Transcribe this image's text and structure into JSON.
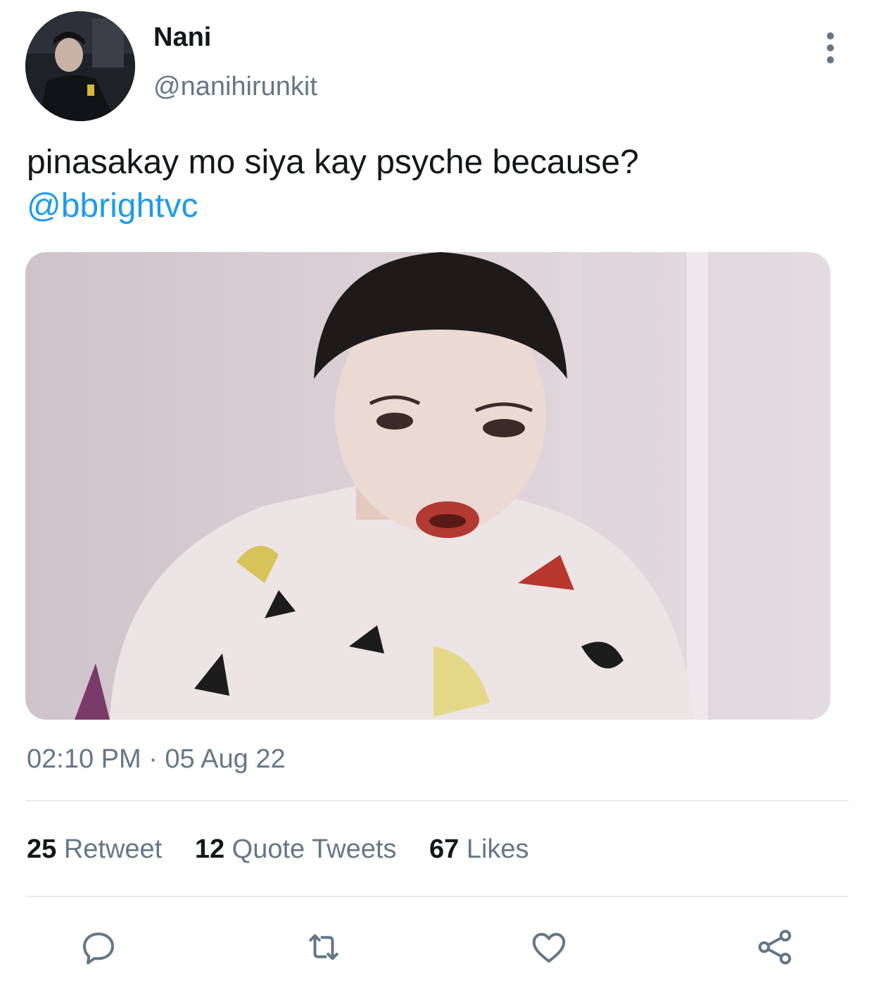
{
  "tweet": {
    "author": {
      "display_name": "Nani",
      "handle": "@nanihirunkit",
      "avatar": "avatar-photo"
    },
    "text_line_1": "pinasakay mo siya kay psyche because?",
    "mention": "@bbrightvc",
    "media": {
      "type": "photo",
      "alt_icon": "photo-image"
    },
    "timestamp": "02:10 PM · 05 Aug 22",
    "stats": {
      "retweets_count": "25",
      "retweets_label": "Retweet",
      "quotes_count": "12",
      "quotes_label": "Quote Tweets",
      "likes_count": "67",
      "likes_label": "Likes"
    },
    "actions": [
      {
        "icon": "reply-icon"
      },
      {
        "icon": "retweet-icon"
      },
      {
        "icon": "like-icon"
      },
      {
        "icon": "share-icon"
      }
    ]
  },
  "colors": {
    "text_primary": "#14171a",
    "text_secondary": "#657786",
    "link": "#1d9bf0",
    "divider": "#e6ecf0"
  }
}
